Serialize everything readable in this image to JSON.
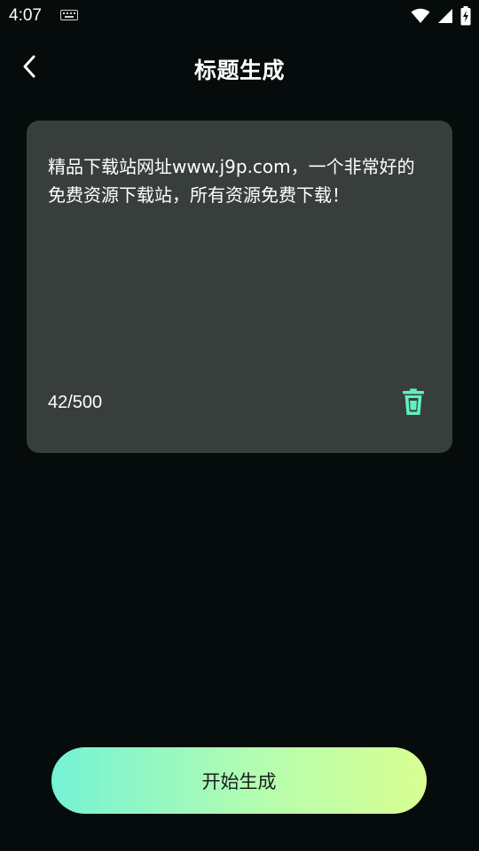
{
  "status_bar": {
    "time": "4:07",
    "icons": [
      "keyboard-icon",
      "wifi-icon",
      "signal-icon",
      "battery-charging-icon"
    ]
  },
  "header": {
    "title": "标题生成",
    "back_icon": "chevron-left-icon"
  },
  "editor": {
    "text": "精品下载站网址www.j9p.com，一个非常好的免费资源下载站，所有资源免费下载！",
    "char_count": "42/500",
    "delete_icon": "trash-icon",
    "delete_color": "#5ff0c0"
  },
  "actions": {
    "start_label": "开始生成"
  },
  "colors": {
    "background": "#050c0b",
    "card": "#383e3c",
    "accent_start": "#74f2d5",
    "accent_end": "#d8ff92"
  }
}
